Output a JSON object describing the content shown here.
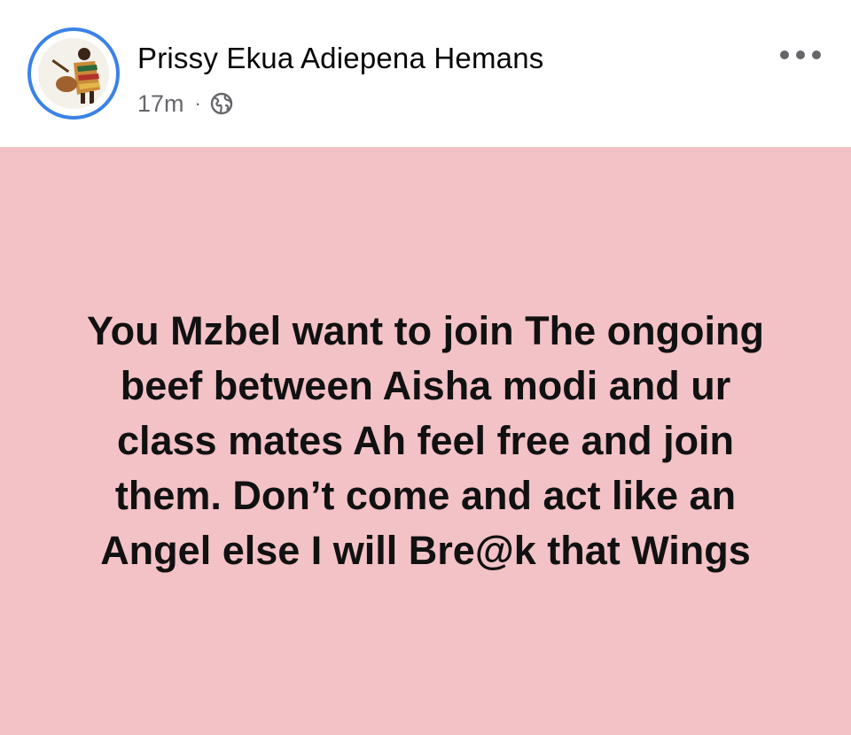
{
  "post": {
    "author": {
      "name": "Prissy Ekua Adiepena Hemans",
      "avatar_icon": "profile-photo-avatar"
    },
    "meta": {
      "time": "17m",
      "separator": "·",
      "privacy_icon": "globe-icon"
    },
    "more_icon": "more-options-icon",
    "body": {
      "background_color": "#f3c2c6",
      "text": "You Mzbel want to join The ongoing beef between Aisha modi and ur class mates Ah feel free and join them. Don’t come and act like an Angel else I will Bre@k that Wings"
    }
  },
  "colors": {
    "avatar_ring": "#3b82e6",
    "meta_gray": "#65676b"
  }
}
